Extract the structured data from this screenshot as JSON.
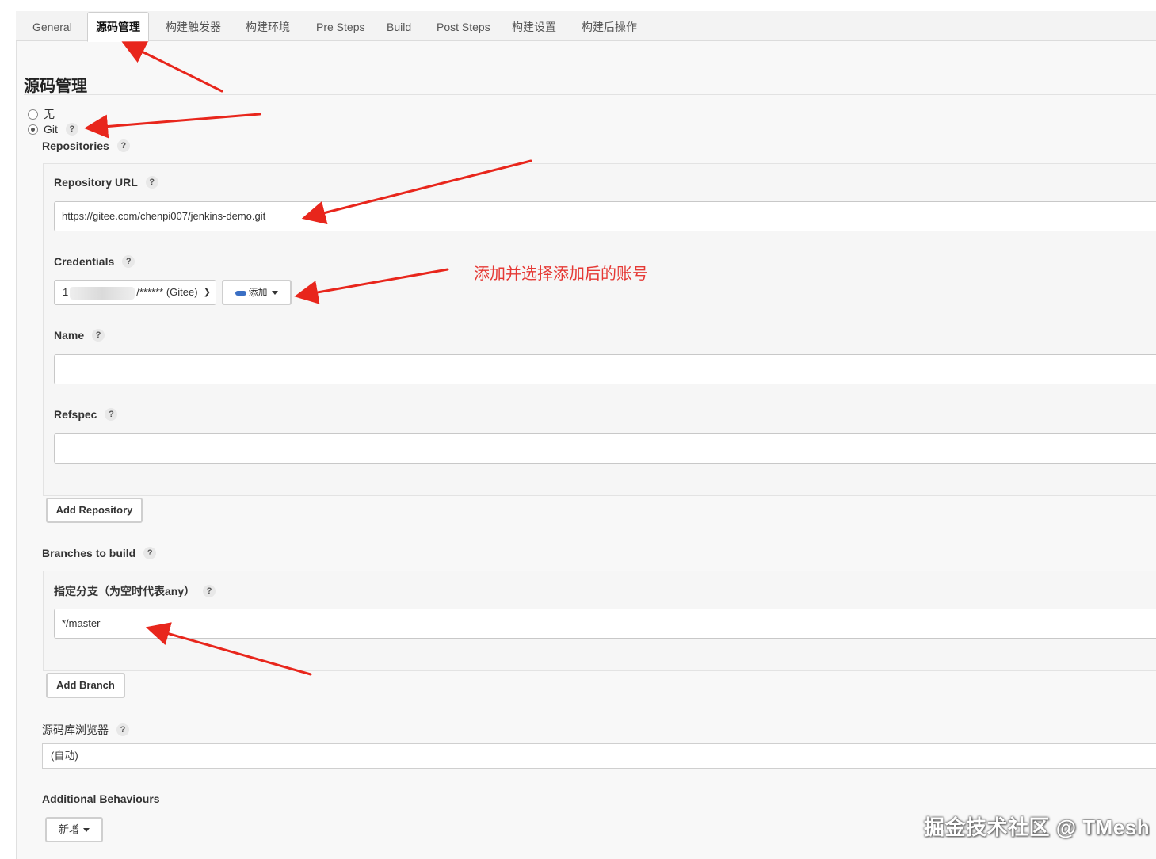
{
  "tabs": [
    {
      "label": "General",
      "active": false
    },
    {
      "label": "源码管理",
      "active": true
    },
    {
      "label": "构建触发器",
      "active": false
    },
    {
      "label": "构建环境",
      "active": false
    },
    {
      "label": "Pre Steps",
      "active": false
    },
    {
      "label": "Build",
      "active": false
    },
    {
      "label": "Post Steps",
      "active": false
    },
    {
      "label": "构建设置",
      "active": false
    },
    {
      "label": "构建后操作",
      "active": false
    }
  ],
  "section": {
    "title": "源码管理"
  },
  "scm": {
    "option_none": "无",
    "option_git": "Git",
    "selected": "Git",
    "help_glyph": "?"
  },
  "repositories": {
    "label": "Repositories",
    "url_label": "Repository URL",
    "url_value": "https://gitee.com/chenpi007/jenkins-demo.git",
    "credentials_label": "Credentials",
    "credentials_prefix": "1",
    "credentials_suffix": "/****** (Gitee)",
    "add_button": "添加",
    "name_label": "Name",
    "name_value": "",
    "refspec_label": "Refspec",
    "refspec_value": "",
    "add_repository_button": "Add Repository"
  },
  "branches": {
    "label": "Branches to build",
    "spec_label": "指定分支（为空时代表any）",
    "spec_value": "*/master",
    "add_branch_button": "Add Branch"
  },
  "browser": {
    "label": "源码库浏览器",
    "value": "(自动)"
  },
  "behaviours": {
    "label": "Additional Behaviours",
    "add_button": "新增"
  },
  "annotation": {
    "text": "添加并选择添加后的账号",
    "color": "#e53935"
  },
  "watermark": {
    "text": "掘金技术社区 @ TMesh"
  },
  "colors": {
    "arrow": "#e8261c",
    "panel": "#f8f8f8"
  }
}
